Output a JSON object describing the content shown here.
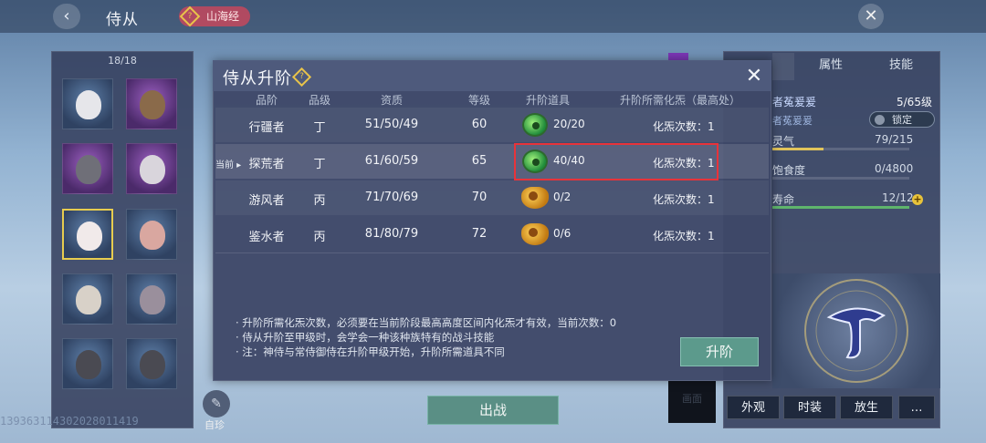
{
  "topbar": {
    "title": "侍从",
    "tag_label": "山海经",
    "tag_icon": "?"
  },
  "roster": {
    "count": "18/18",
    "slots": [
      {
        "name": "white-hair-doll",
        "rarity": "blue"
      },
      {
        "name": "capybara",
        "rarity": "purple"
      },
      {
        "name": "rhino-beast",
        "rarity": "purple"
      },
      {
        "name": "mer-kitten",
        "rarity": "purple"
      },
      {
        "name": "white-hair-girl",
        "rarity": "blue",
        "selected": true
      },
      {
        "name": "mouse-beast",
        "rarity": "blue"
      },
      {
        "name": "mer-kitten",
        "rarity": "blue"
      },
      {
        "name": "grey-beast-elder",
        "rarity": "blue"
      },
      {
        "name": "husky-mer",
        "rarity": "blue"
      },
      {
        "name": "husky-mer",
        "rarity": "blue"
      }
    ]
  },
  "uid_text": "1393631143020280​11419",
  "self_label": "自珍",
  "deploy_label": "出战",
  "right_panel": {
    "tabs": [
      "属性",
      "技能"
    ],
    "rows": [
      {
        "label": "者菟爰爰",
        "value": "5/65级"
      },
      {
        "label": "者菟爰爰",
        "lock_label": "锁定"
      },
      {
        "label": "灵气",
        "value": "79/215",
        "fill": 0.37
      },
      {
        "label": "饱食度",
        "value": "0/4800",
        "fill": 0
      },
      {
        "label": "寿命",
        "value": "12/12",
        "fill": 1.0
      }
    ],
    "buttons": [
      "外观",
      "时装",
      "放生",
      "…"
    ],
    "dark_box_label": "画面"
  },
  "modal": {
    "title": "侍从升阶",
    "help_icon": "?",
    "close_icon": "✕",
    "headers": [
      "品阶",
      "品级",
      "资质",
      "等级",
      "升阶道具",
      "升阶所需化炁（最高处）"
    ],
    "current_marker": "当前 ▸",
    "rows": [
      {
        "tier": "行疆者",
        "grade": "丁",
        "aptitude": "51/50/49",
        "level": "60",
        "item_icon": "jade-ring-icon",
        "item_count": "20/20",
        "transform": "化炁次数：1"
      },
      {
        "tier": "探荒者",
        "grade": "丁",
        "aptitude": "61/60/59",
        "level": "65",
        "item_icon": "jade-ring-icon",
        "item_count": "40/40",
        "transform": "化炁次数：1",
        "current": true
      },
      {
        "tier": "游风者",
        "grade": "丙",
        "aptitude": "71/70/69",
        "level": "70",
        "item_icon": "nut-icon",
        "item_count": "0/2",
        "transform": "化炁次数：1"
      },
      {
        "tier": "鉴水者",
        "grade": "丙",
        "aptitude": "81/80/79",
        "level": "72",
        "item_icon": "nut-icon",
        "item_count": "0/6",
        "transform": "化炁次数：1"
      }
    ],
    "notes": [
      "· 升阶所需化炁次数，必须要在当前阶段最高高度区间内化炁才有效，当前次数：0",
      "· 侍从升阶至甲级时，会学会一种该种族特有的战斗技能",
      "· 注：神侍与常侍御侍在升阶甲级开始，升阶所需道具不同"
    ],
    "upgrade_label": "升阶"
  }
}
